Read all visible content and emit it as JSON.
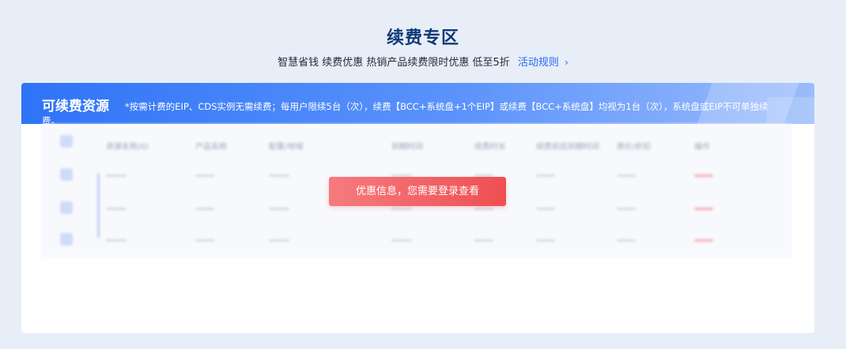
{
  "page": {
    "title": "续费专区",
    "subtitle": "智慧省钱 续费优惠 热销产品续费限时优惠 低至5折",
    "rules_link": "活动规则",
    "rules_chevron": "›"
  },
  "card": {
    "title": "可续费资源",
    "note": "*按需计费的EIP、CDS实例无需续费；每用户限续5台（次），续费【BCC+系统盘+1个EIP】或续费【BCC+系统盘】均视为1台（次），系统盘或EIP不可单独续",
    "note_overflow": "费。"
  },
  "table": {
    "headers": [
      "资源名称/ID",
      "产品名称",
      "配置/地域",
      "到期时间",
      "续费时长",
      "续费前后到期时间",
      "原价/折扣",
      "操作"
    ],
    "row_count": 3
  },
  "login_prompt": "优惠信息，您需要登录查看",
  "colors": {
    "accent": "#2468f2",
    "header_gradient_start": "#2f73f7",
    "login_button": "#ef4f52",
    "title": "#0d3a78"
  }
}
